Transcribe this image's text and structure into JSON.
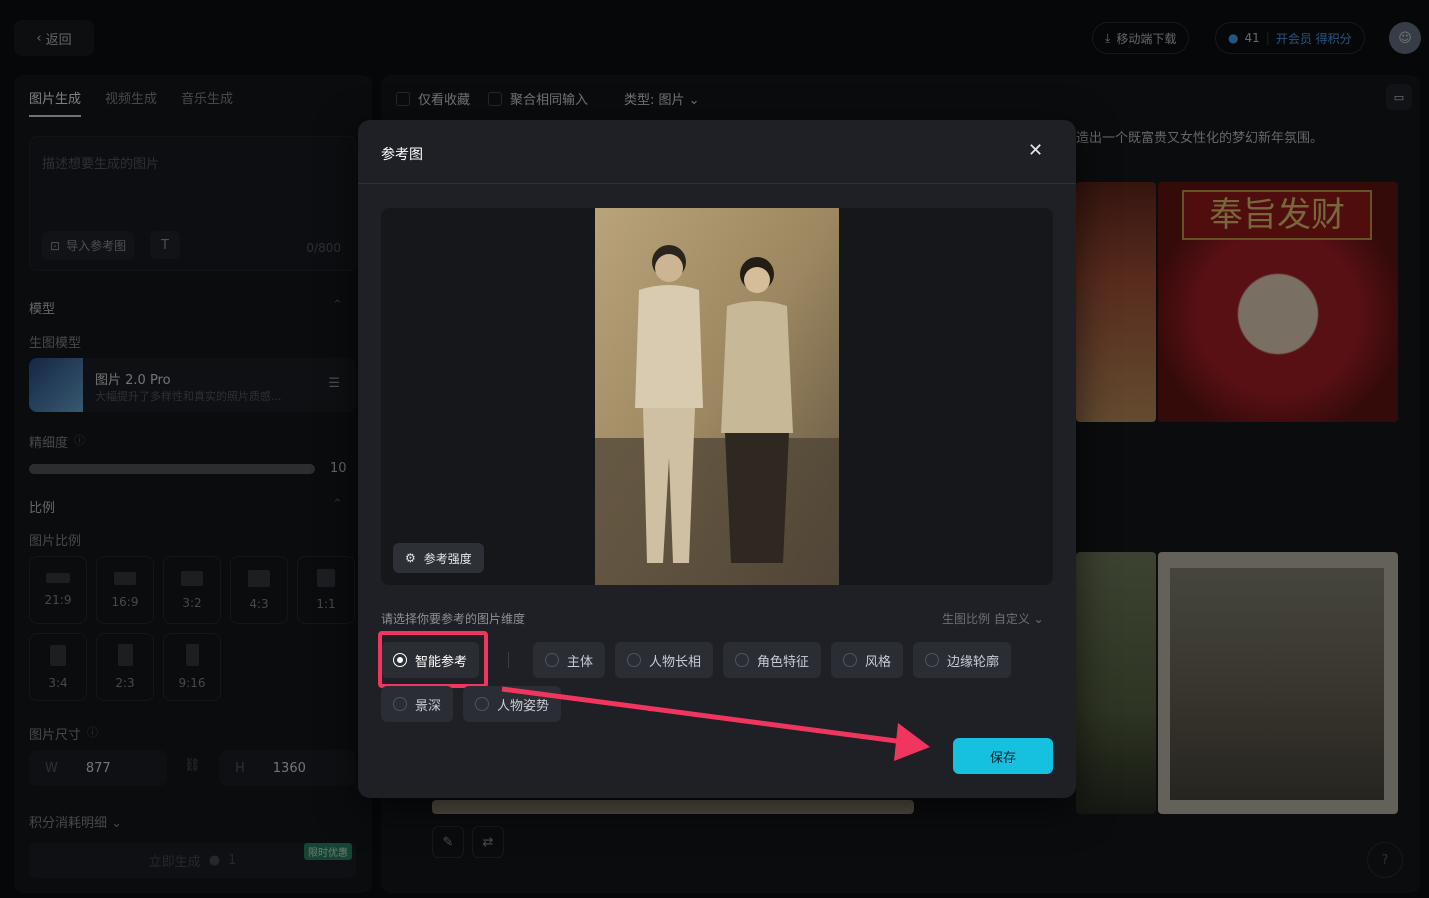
{
  "topbar": {
    "back": "返回",
    "mobile": "移动端下载",
    "points": "41",
    "member": "开会员 得积分"
  },
  "left": {
    "tabs": [
      "图片生成",
      "视频生成",
      "音乐生成"
    ],
    "prompt_placeholder": "描述想要生成的图片",
    "import_ref": "导入参考图",
    "char_count": "0/800",
    "model_section": "模型",
    "gen_model": "生图模型",
    "model_name": "图片 2.0 Pro",
    "model_desc": "大幅提升了多样性和真实的照片质感...",
    "fineness": "精细度",
    "fineness_value": "10",
    "fineness_level": 1.0,
    "ratio_section": "比例",
    "ratio_label": "图片比例",
    "ratios": [
      "21:9",
      "16:9",
      "3:2",
      "4:3",
      "1:1",
      "3:4",
      "2:3",
      "9:16"
    ],
    "size_label": "图片尺寸",
    "w_label": "W",
    "w_value": "877",
    "h_label": "H",
    "h_value": "1360",
    "cost_detail": "积分消耗明细",
    "generate": "立即生成",
    "generate_cost": "1",
    "promo": "限时优惠"
  },
  "right": {
    "only_fav": "仅看收藏",
    "merge_same": "聚合相同输入",
    "type_filter": "类型: 图片",
    "caption_tail": "造出一个既富贵又女性化的梦幻新年氛围。",
    "banner_text": "奉旨发财"
  },
  "modal": {
    "title": "参考图",
    "strength_btn": "参考强度",
    "dimension_prompt": "请选择你要参考的图片维度",
    "ratio_select": "生图比例 自定义",
    "options": [
      "智能参考",
      "主体",
      "人物长相",
      "角色特征",
      "风格",
      "边缘轮廓",
      "景深",
      "人物姿势"
    ],
    "selected": "智能参考",
    "save": "保存"
  },
  "colors": {
    "accent": "#16c0df",
    "highlight": "#f0365f"
  }
}
